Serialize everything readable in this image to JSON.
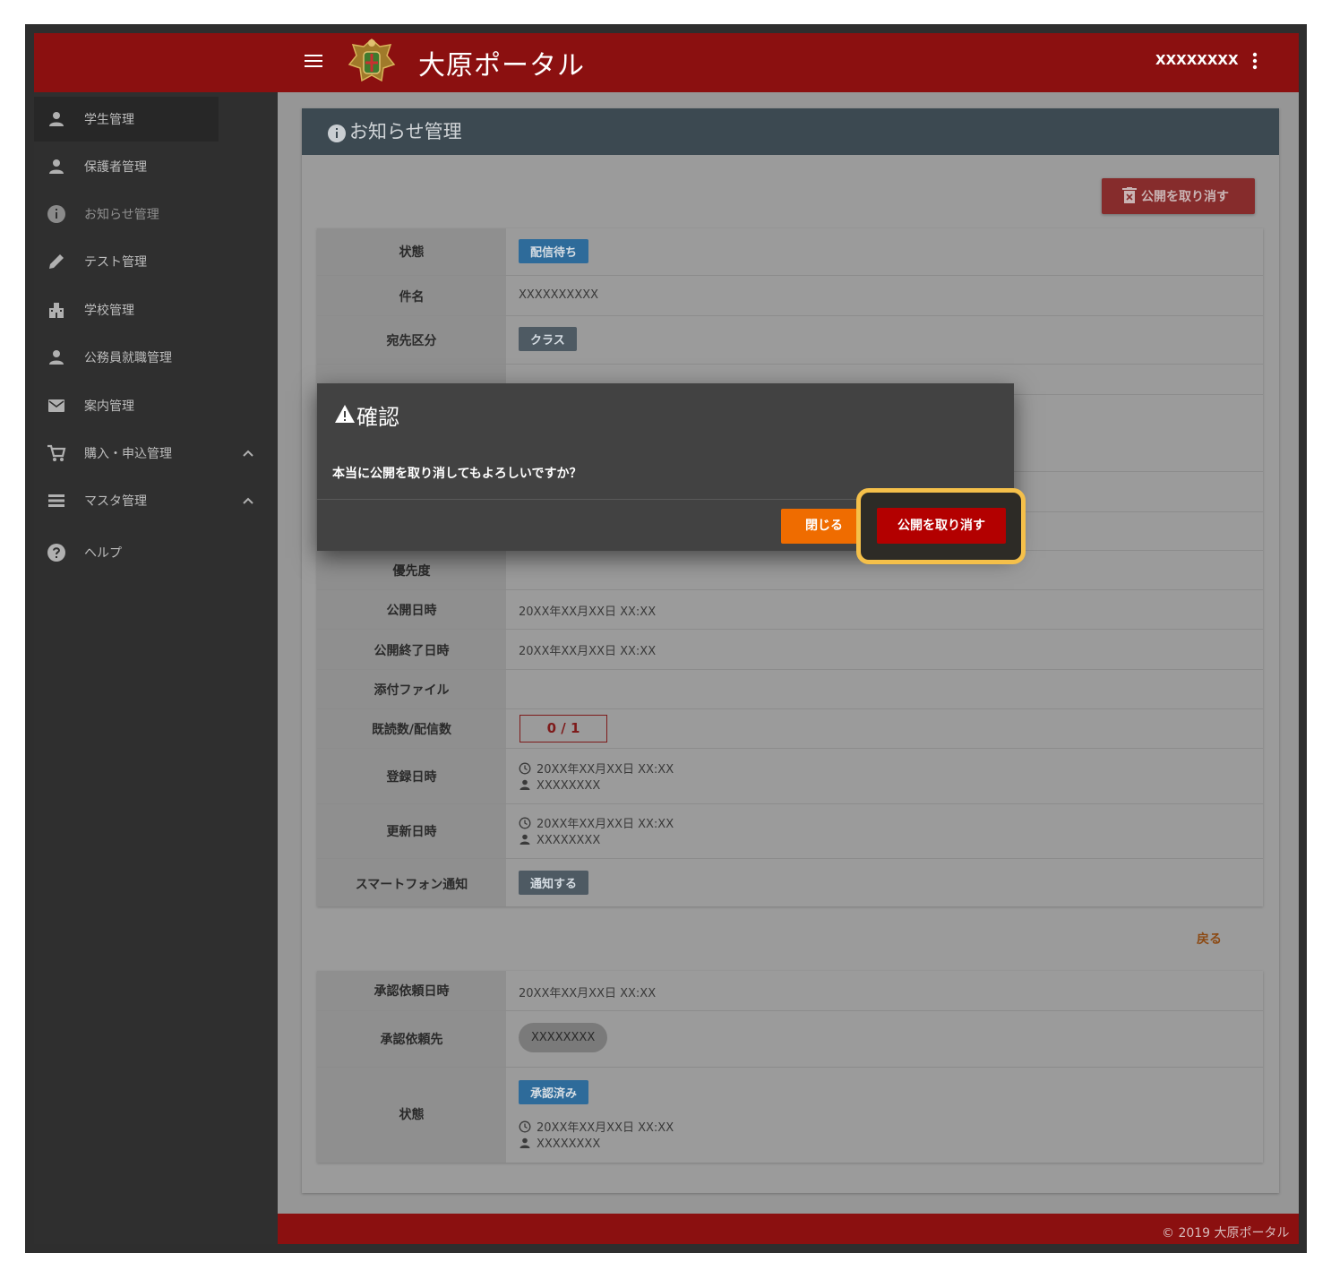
{
  "header": {
    "app_title": "大原ポータル",
    "user_name": "XXXXXXXX"
  },
  "sidebar": {
    "items": [
      {
        "label": "学生管理",
        "icon": "person-icon"
      },
      {
        "label": "保護者管理",
        "icon": "person-icon"
      },
      {
        "label": "お知らせ管理",
        "icon": "info-icon"
      },
      {
        "label": "テスト管理",
        "icon": "pencil-icon"
      },
      {
        "label": "学校管理",
        "icon": "building-icon"
      },
      {
        "label": "公務員就職管理",
        "icon": "person-icon"
      },
      {
        "label": "案内管理",
        "icon": "mail-icon"
      },
      {
        "label": "購入・申込管理",
        "icon": "cart-icon"
      },
      {
        "label": "マスタ管理",
        "icon": "list-icon"
      },
      {
        "label": "ヘルプ",
        "icon": "help-icon"
      }
    ]
  },
  "page": {
    "title": "お知らせ管理",
    "unpublish_button": "公開を取り消す",
    "back_link": "戻る"
  },
  "details": {
    "status_label": "状態",
    "status_value": "配信待ち",
    "subject_label": "件名",
    "subject_value": "XXXXXXXXXX",
    "dest_type_label": "宛先区分",
    "dest_type_value": "クラス",
    "priority_label": "優先度",
    "publish_date_label": "公開日時",
    "publish_date_value": "20XX年XX月XX日 XX:XX",
    "publish_end_label": "公開終了日時",
    "publish_end_value": "20XX年XX月XX日 XX:XX",
    "attachment_label": "添付ファイル",
    "read_count_label": "既読数/配信数",
    "read_count_value": "0 / 1",
    "registered_label": "登録日時",
    "registered_date": "20XX年XX月XX日 XX:XX",
    "registered_user": "XXXXXXXX",
    "updated_label": "更新日時",
    "updated_date": "20XX年XX月XX日 XX:XX",
    "updated_user": "XXXXXXXX",
    "smartphone_label": "スマートフォン通知",
    "smartphone_value": "通知する"
  },
  "approval": {
    "request_date_label": "承認依頼日時",
    "request_date_value": "20XX年XX月XX日 XX:XX",
    "request_to_label": "承認依頼先",
    "request_to_value": "XXXXXXXX",
    "status_label": "状態",
    "status_value": "承認済み",
    "status_date": "20XX年XX月XX日 XX:XX",
    "status_user": "XXXXXXXX"
  },
  "dialog": {
    "title": "確認",
    "message": "本当に公開を取り消してもよろしいですか？",
    "close_button": "閉じる",
    "confirm_button": "公開を取り消す"
  },
  "footer": {
    "text": "© 2019 大原ポータル"
  },
  "colors": {
    "brand_red": "#8b1010",
    "confirm_red": "#b30000",
    "close_orange": "#ef6c00",
    "highlight_yellow": "#f5c04a"
  }
}
